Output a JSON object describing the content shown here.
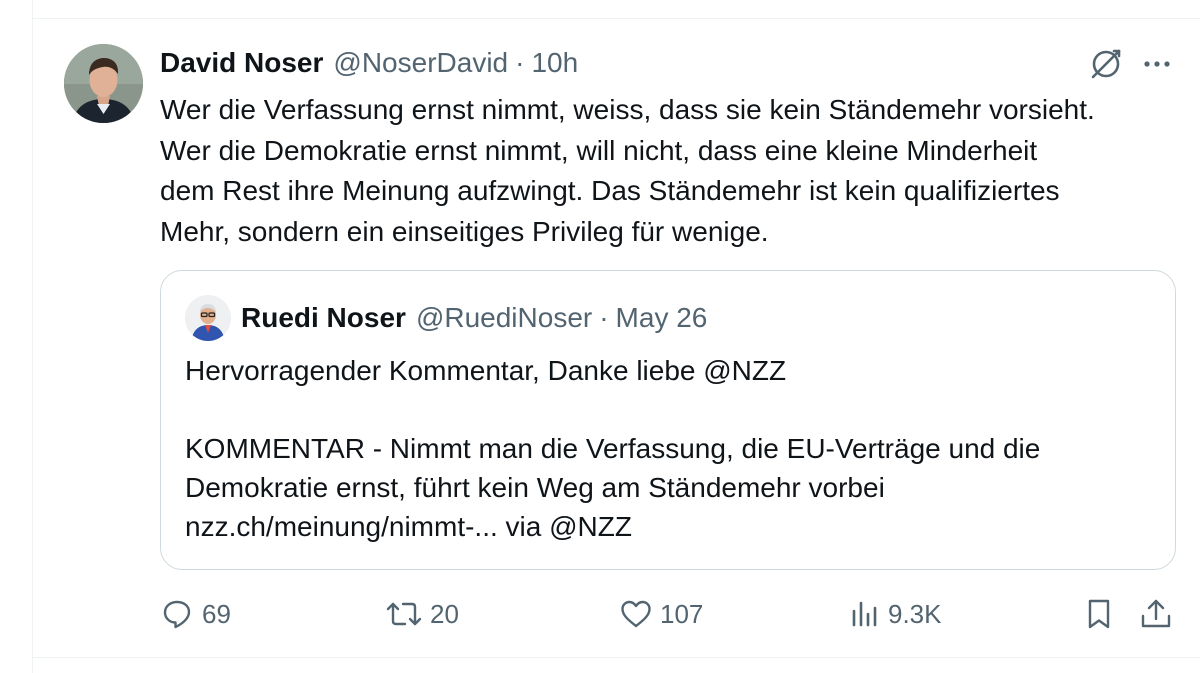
{
  "tweet": {
    "author_name": "David Noser",
    "author_handle": "@NoserDavid",
    "separator": "·",
    "time": "10h",
    "text_lines": [
      "Wer die Verfassung ernst nimmt, weiss, dass sie kein Ständemehr vorsieht.",
      "Wer die Demokratie ernst nimmt, will nicht, dass eine kleine Minderheit",
      "dem Rest ihre Meinung aufzwingt. Das Ständemehr ist kein qualifiziertes",
      "Mehr, sondern ein einseitiges Privileg für wenige."
    ]
  },
  "quote": {
    "author_name": "Ruedi Noser",
    "author_handle": "@RuediNoser",
    "separator": "·",
    "date": "May 26",
    "text_lines": [
      "Hervorragender Kommentar, Danke liebe @NZZ",
      "",
      "KOMMENTAR - Nimmt man die Verfassung, die EU-Verträge und die",
      "Demokratie ernst, führt kein Weg am Ständemehr vorbei",
      "nzz.ch/meinung/nimmt-... via @NZZ"
    ]
  },
  "actions": {
    "reply_count": "69",
    "repost_count": "20",
    "like_count": "107",
    "views_count": "9.3K"
  },
  "icons": {
    "header": [
      "grok-icon",
      "more-icon"
    ],
    "actions": [
      "reply-icon",
      "repost-icon",
      "like-icon",
      "views-icon",
      "bookmark-icon",
      "share-icon"
    ]
  },
  "colors": {
    "text_primary": "#0f1419",
    "text_secondary": "#536471",
    "border": "#cfd9de"
  }
}
